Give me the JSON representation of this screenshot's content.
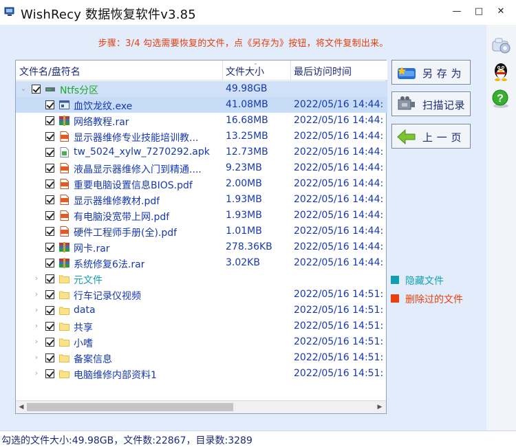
{
  "window": {
    "title": "WishRecy 数据恢复软件v3.85",
    "minimize": "—",
    "maximize": "□",
    "close": "✕"
  },
  "step_text": "步骤：3/4 勾选需要恢复的文件，点《另存为》按钮，将文件复制出来。",
  "list": {
    "columns": [
      "文件名/盘符名",
      "文件大小",
      "最后访问时间"
    ],
    "root": {
      "name": "Ntfs分区",
      "size": "49.98GB"
    },
    "files": [
      {
        "name": "血饮龙纹.exe",
        "size": "41.08MB",
        "date": "2022/05/16 14:44:",
        "icon": "exe-icon"
      },
      {
        "name": "网络教程.rar",
        "size": "16.68MB",
        "date": "2022/05/16 14:44:",
        "icon": "rar-icon"
      },
      {
        "name": "显示器维修专业技能培训教...",
        "size": "13.25MB",
        "date": "2022/05/16 14:44:",
        "icon": "pdf-icon"
      },
      {
        "name": "tw_5024_xylw_7270292.apk",
        "size": "12.73MB",
        "date": "2022/05/16 14:44:",
        "icon": "apk-icon"
      },
      {
        "name": "液晶显示器维修入门到精通....",
        "size": "9.23MB",
        "date": "2022/05/16 14:44:",
        "icon": "pdf-icon"
      },
      {
        "name": "重要电脑设置信息BIOS.pdf",
        "size": "2.00MB",
        "date": "2022/05/16 14:44:",
        "icon": "pdf-icon"
      },
      {
        "name": "显示器维修教材.pdf",
        "size": "1.93MB",
        "date": "2022/05/16 14:44:",
        "icon": "pdf-icon"
      },
      {
        "name": "有电脑没宽带上网.pdf",
        "size": "1.93MB",
        "date": "2022/05/16 14:44:",
        "icon": "pdf-icon"
      },
      {
        "name": "硬件工程师手册(全).pdf",
        "size": "1.01MB",
        "date": "2022/05/16 14:44:",
        "icon": "pdf-icon"
      },
      {
        "name": "网卡.rar",
        "size": "278.36KB",
        "date": "2022/05/16 14:44:",
        "icon": "rar-icon"
      },
      {
        "name": "系统修复6法.rar",
        "size": "3.02KB",
        "date": "2022/05/16 14:44:",
        "icon": "rar-icon"
      }
    ],
    "folders": [
      {
        "name": "元文件",
        "date": "",
        "hidden": true
      },
      {
        "name": "行车记录仪视频",
        "date": "2022/05/16 14:51:"
      },
      {
        "name": "data",
        "date": "2022/05/16 14:51:"
      },
      {
        "name": "共享",
        "date": "2022/05/16 14:51:"
      },
      {
        "name": "小嗜",
        "date": "2022/05/16 14:51:"
      },
      {
        "name": "备案信息",
        "date": "2022/05/16 14:51:"
      },
      {
        "name": "电脑维修内部资料1",
        "date": "2022/05/16 14:51:"
      }
    ]
  },
  "buttons": {
    "save_as": "另 存 为",
    "scan_record": "扫描记录",
    "prev_page": "上 一 页"
  },
  "legend": {
    "hidden": "隐藏文件",
    "deleted": "删除过的文件"
  },
  "status": "勾选的文件大小:49.98GB，文件数:22867，目录数:3289",
  "colors": {
    "hidden_file": "#0f9fb3",
    "deleted_file": "#e8400e",
    "root_label": "#1ea82c",
    "file_text": "#1638b0"
  }
}
